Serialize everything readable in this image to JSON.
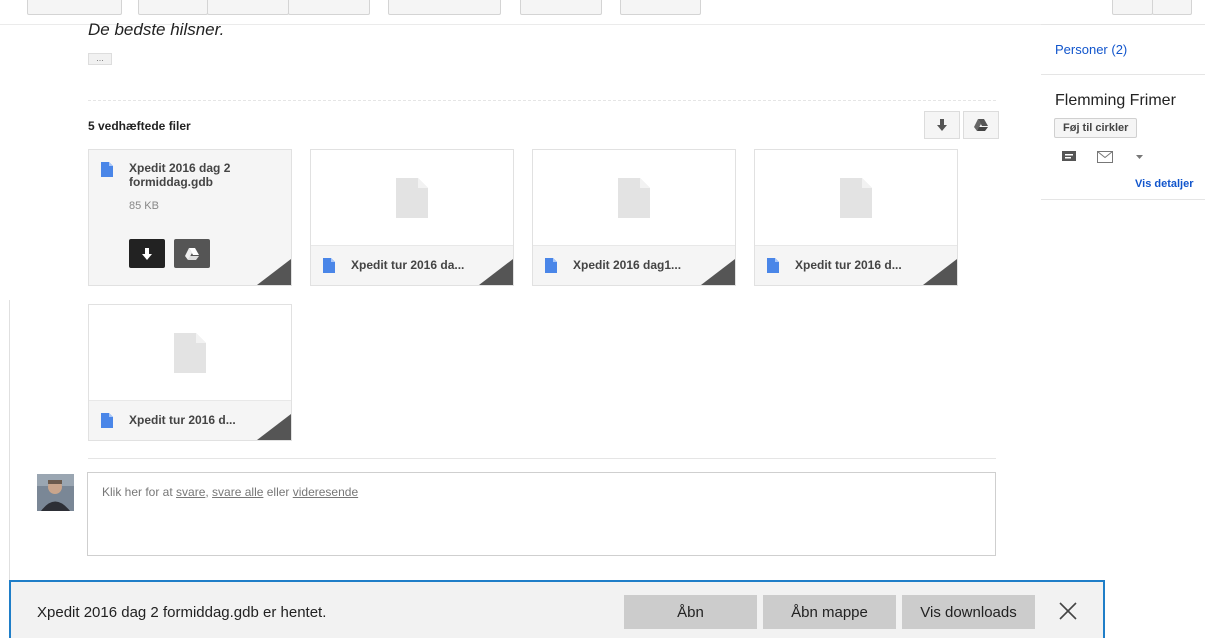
{
  "message": {
    "greeting": "De bedste hilsner.",
    "ellipsis": "..."
  },
  "attachments": {
    "heading": "5 vedhæftede filer",
    "expanded": {
      "name": "Xpedit 2016 dag 2 formiddag.gdb",
      "size": "85 KB"
    },
    "cards": [
      {
        "name": "Xpedit tur 2016 da..."
      },
      {
        "name": "Xpedit 2016 dag1..."
      },
      {
        "name": "Xpedit tur 2016 d..."
      },
      {
        "name": "Xpedit tur 2016 d..."
      }
    ]
  },
  "reply": {
    "prefix": "Klik her for at ",
    "reply": "svare",
    "sep": ", ",
    "reply_all": "svare alle",
    "or": " eller ",
    "forward": "videresende"
  },
  "sidebar": {
    "persons": "Personer (2)",
    "person_name": "Flemming Frimer",
    "add_to_circles": "Føj til cirkler",
    "show_details": "Vis detaljer"
  },
  "download_bar": {
    "message": "Xpedit 2016 dag 2 formiddag.gdb er hentet.",
    "open": "Åbn",
    "open_folder": "Åbn mappe",
    "show_downloads": "Vis downloads"
  },
  "colors": {
    "link": "#1155cc",
    "file_icon": "#4a86e8",
    "download_bar_border": "#1f7ec8"
  }
}
